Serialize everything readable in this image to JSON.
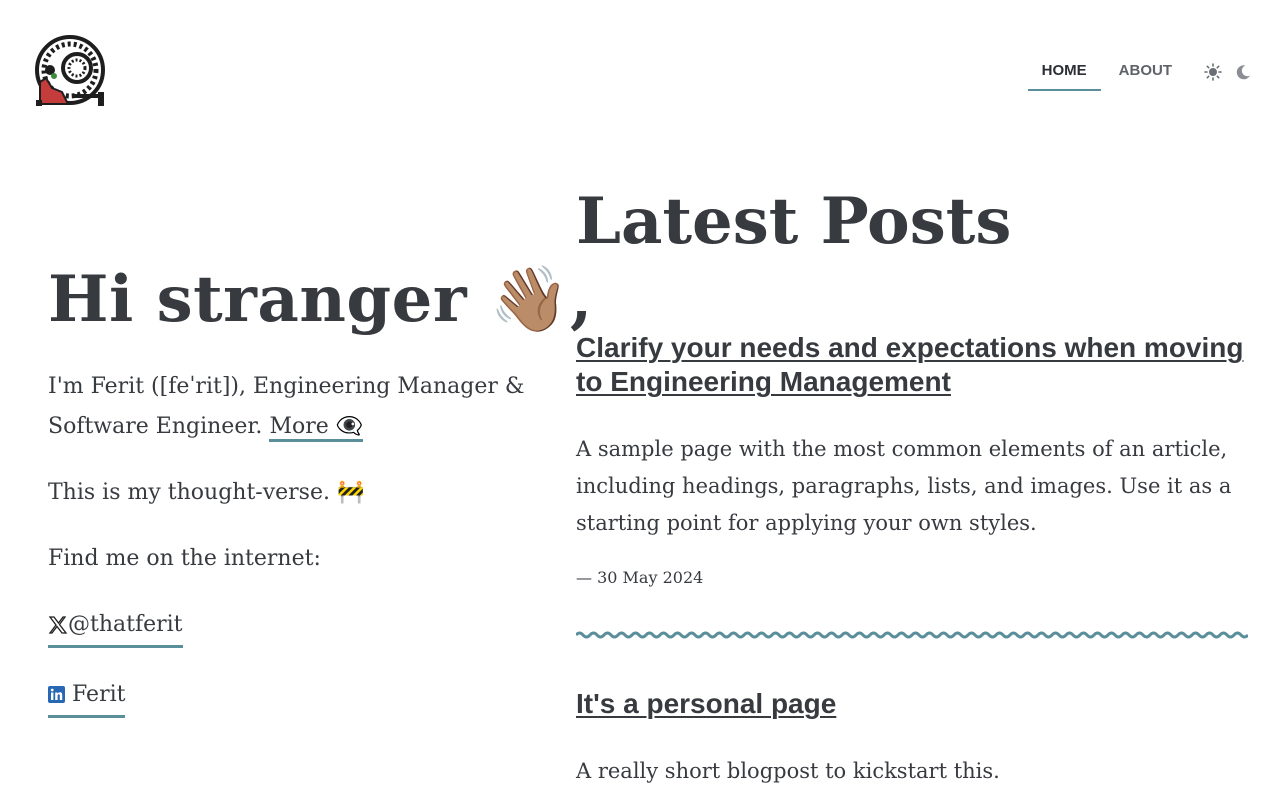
{
  "nav": {
    "items": [
      {
        "label": "HOME",
        "active": true
      },
      {
        "label": "ABOUT",
        "active": false
      }
    ],
    "theme_icons": [
      "sun-icon",
      "moon-icon"
    ]
  },
  "intro": {
    "greeting": "Hi stranger",
    "greeting_emoji": "👋🏽",
    "greeting_suffix": ",",
    "bio_text": "I'm Ferit ([feˈrit]), Engineering Manager & Software Engineer.",
    "more_link": "More 👁‍🗨",
    "thought_text": "This is my thought-verse. 🚧",
    "find_me": "Find me on the internet:",
    "twitter_handle": "@thatferit",
    "linkedin_name": "Ferit"
  },
  "posts": {
    "section_title": "Latest Posts",
    "items": [
      {
        "title": "Clarify your needs and expectations when moving to Engineering Management",
        "description": "A sample page with the most common elements of an article, including headings, paragraphs, lists, and images. Use it as a starting point for applying your own styles.",
        "date": "— 30 May 2024"
      },
      {
        "title": "It's a personal page",
        "description": "A really short blogpost to kickstart this."
      }
    ]
  },
  "colors": {
    "text": "#373a3f",
    "accent": "#5a8e9a",
    "linkedin": "#2867b2"
  }
}
